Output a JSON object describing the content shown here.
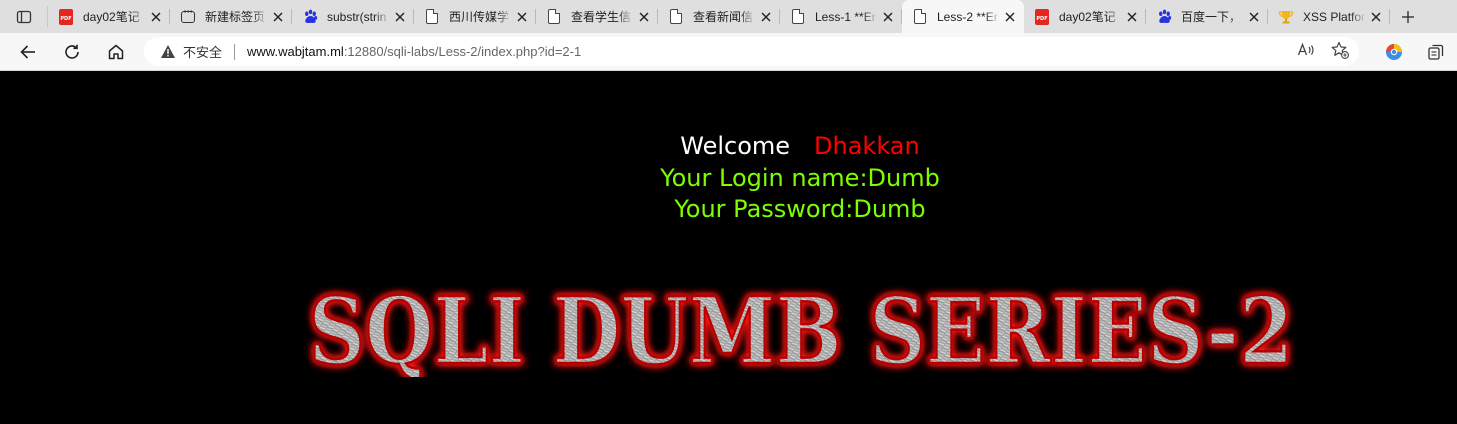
{
  "browser": {
    "tabs": [
      {
        "title": "day02笔记",
        "favicon": "pdf-icon",
        "active": false
      },
      {
        "title": "新建标签页",
        "favicon": "newtab-icon",
        "active": false
      },
      {
        "title": "substr(strin",
        "favicon": "baidu-icon",
        "active": false
      },
      {
        "title": "西川传媒学",
        "favicon": "page-icon",
        "active": false
      },
      {
        "title": "查看学生信",
        "favicon": "page-icon",
        "active": false
      },
      {
        "title": "查看新闻信",
        "favicon": "page-icon",
        "active": false
      },
      {
        "title": "Less-1 **Er",
        "favicon": "page-icon",
        "active": false
      },
      {
        "title": "Less-2 **Er",
        "favicon": "page-icon",
        "active": true
      },
      {
        "title": "day02笔记",
        "favicon": "pdf-icon",
        "active": false
      },
      {
        "title": "百度一下，",
        "favicon": "baidu-icon",
        "active": false
      },
      {
        "title": "XSS Platfor",
        "favicon": "trophy-icon",
        "active": false
      }
    ],
    "address": {
      "security_label": "不安全",
      "url_host": "www.wabjtam.ml",
      "url_rest": ":12880/sqli-labs/Less-2/index.php?id=2-1"
    }
  },
  "page": {
    "welcome": "Welcome",
    "user_name": "Dhakkan",
    "login_name": "Your Login name:Dumb",
    "password": "Your Password:Dumb",
    "banner_text": "SQLI DUMB SERIES-2"
  },
  "colors": {
    "background": "#000000",
    "welcome": "#ffffff",
    "name": "#ff0000",
    "result": "#7cff00",
    "banner_glow": "#ff1a1a"
  }
}
